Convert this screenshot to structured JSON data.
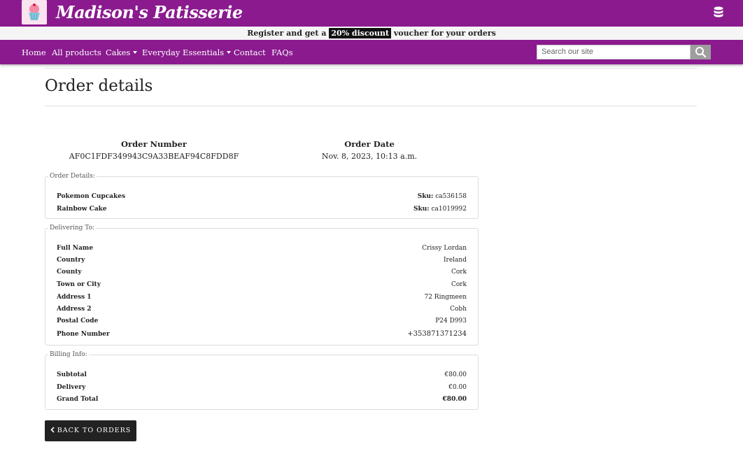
{
  "header": {
    "brand": "Madison's Patisserie",
    "logo_icon": "cupcake-icon",
    "account_icon": "database-icon"
  },
  "promo": {
    "before": "Register and get a ",
    "highlight": "20% discount",
    "after": " voucher for your orders"
  },
  "nav": {
    "items": [
      "Home",
      "All products",
      "Cakes",
      "Everyday Essentials",
      "Contact",
      "FAQs"
    ],
    "search_placeholder": "Search our site"
  },
  "page": {
    "title": "Order details"
  },
  "summary": {
    "order_number_label": "Order Number",
    "order_number": "AF0C1FDF349943C9A33BEAF94C8FDD8F",
    "order_date_label": "Order Date",
    "order_date": "Nov. 8, 2023, 10:13 a.m."
  },
  "order_details": {
    "legend": "Order Details:",
    "sku_label": "Sku:",
    "items": [
      {
        "name": "Pokemon Cupcakes",
        "sku": "ca536158"
      },
      {
        "name": "Rainbow Cake",
        "sku": "ca1019992"
      }
    ]
  },
  "delivery": {
    "legend": "Delivering To:",
    "rows": [
      {
        "label": "Full Name",
        "value": "Crissy Lordan"
      },
      {
        "label": "Country",
        "value": "Ireland"
      },
      {
        "label": "County",
        "value": "Cork"
      },
      {
        "label": "Town or City",
        "value": "Cork"
      },
      {
        "label": "Address 1",
        "value": "72 Ringmeen"
      },
      {
        "label": "Address 2",
        "value": "Cobh"
      },
      {
        "label": "Postal Code",
        "value": "P24 D993"
      },
      {
        "label": "Phone Number",
        "value": "+353871371234"
      }
    ]
  },
  "billing": {
    "legend": "Billing Info:",
    "rows": [
      {
        "label": "Subtotal",
        "value": "€80.00"
      },
      {
        "label": "Delivery",
        "value": "€0.00"
      },
      {
        "label": "Grand Total",
        "value": "€80.00"
      }
    ]
  },
  "actions": {
    "back_label": "BACK TO ORDERS",
    "back_icon": "chevron-left-icon"
  },
  "colors": {
    "brand_purple": "#8a1a8e",
    "button_dark": "#222222"
  }
}
